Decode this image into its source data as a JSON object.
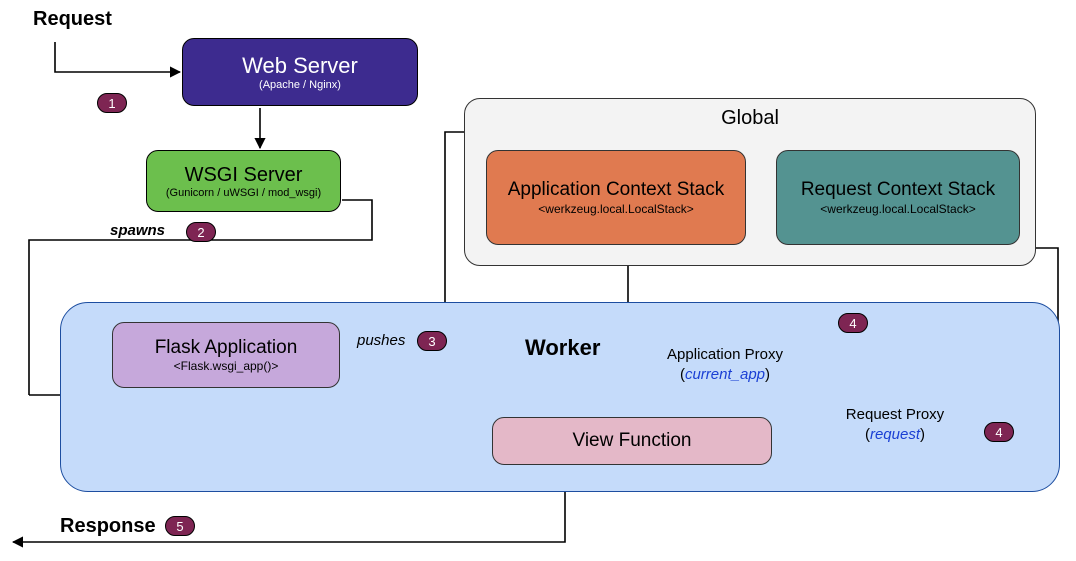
{
  "labels": {
    "request": "Request",
    "response": "Response",
    "spawns": "spawns",
    "pushes": "pushes",
    "global": "Global",
    "worker": "Worker",
    "app_proxy_line1": "Application Proxy",
    "app_proxy_line2": "current_app",
    "req_proxy_line1": "Request Proxy",
    "req_proxy_line2": "request"
  },
  "boxes": {
    "web_server": {
      "title": "Web Server",
      "sub": "(Apache / Nginx)"
    },
    "wsgi_server": {
      "title": "WSGI Server",
      "sub": "(Gunicorn / uWSGI / mod_wsgi)"
    },
    "app_ctx": {
      "title": "Application Context Stack",
      "sub": "<werkzeug.local.LocalStack>"
    },
    "req_ctx": {
      "title": "Request Context Stack",
      "sub": "<werkzeug.local.LocalStack>"
    },
    "flask_app": {
      "title": "Flask Application",
      "sub": "<Flask.wsgi_app()>"
    },
    "view_fn": {
      "title": "View Function"
    }
  },
  "badges": {
    "b1": "1",
    "b2": "2",
    "b3": "3",
    "b4a": "4",
    "b4b": "4",
    "b5": "5"
  }
}
